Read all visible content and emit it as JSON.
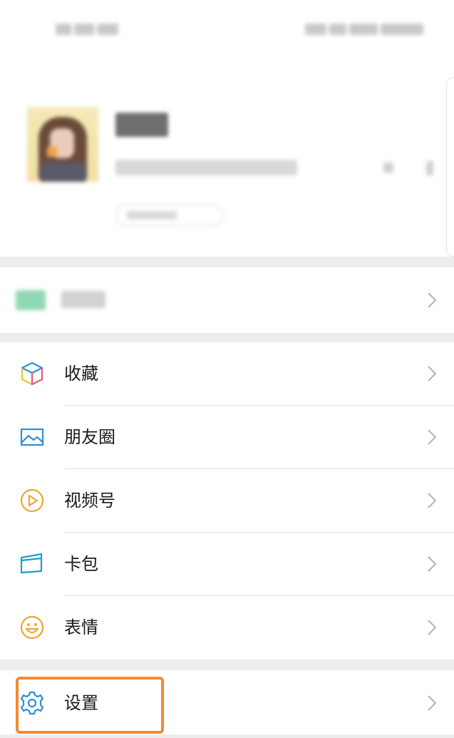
{
  "menu": {
    "items": [
      {
        "label": "收藏",
        "icon": "favorites-cube-icon"
      },
      {
        "label": "朋友圈",
        "icon": "moments-photo-icon"
      },
      {
        "label": "视频号",
        "icon": "channels-play-icon"
      },
      {
        "label": "卡包",
        "icon": "cards-wallet-icon"
      },
      {
        "label": "表情",
        "icon": "stickers-smiley-icon"
      }
    ]
  },
  "settings": {
    "label": "设置",
    "icon": "gear-icon",
    "highlight_color": "#f28a32"
  },
  "colors": {
    "background_gap": "#ededed",
    "divider": "#e5e5e5",
    "icon_blue": "#2e8fd8",
    "icon_orange": "#f2a531",
    "icon_teal": "#1aa0c8"
  }
}
